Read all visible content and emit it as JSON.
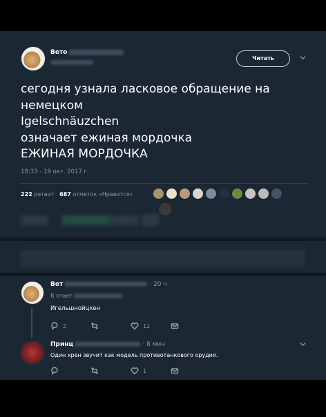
{
  "tweet": {
    "author_name": "Вето",
    "follow_label": "Читать",
    "text_lines": [
      "сегодня узнала ласковое обращение на",
      "немецком",
      "Igelschnäuzchen",
      "означает ежиная мордочка",
      "ЕЖИНАЯ МОРДОЧКА"
    ],
    "timestamp": "18:33 - 19 окт. 2017 г.",
    "retweets_count": "222",
    "retweets_label": "ретвит",
    "likes_count": "687",
    "likes_label": "отметок «Нравится»"
  },
  "replies": [
    {
      "author_name": "Вет",
      "time": "· 20 ч",
      "reply_to_label": "В ответ",
      "text": "Игельшнойцхен",
      "reply_count": "2",
      "retweet_count": "",
      "like_count": "12"
    },
    {
      "author_name": "Принц",
      "time": "· 8 мин",
      "text": "Один хрен звучит как модель противотанкового орудия.",
      "reply_count": "",
      "retweet_count": "",
      "like_count": "1"
    }
  ],
  "icons": {
    "chevron": "chevron-down-icon",
    "reply": "reply-icon",
    "retweet": "retweet-icon",
    "like": "heart-icon",
    "message": "envelope-icon"
  },
  "colors": {
    "background": "#1b2733",
    "muted": "#8899a6",
    "text": "#ffffff"
  }
}
